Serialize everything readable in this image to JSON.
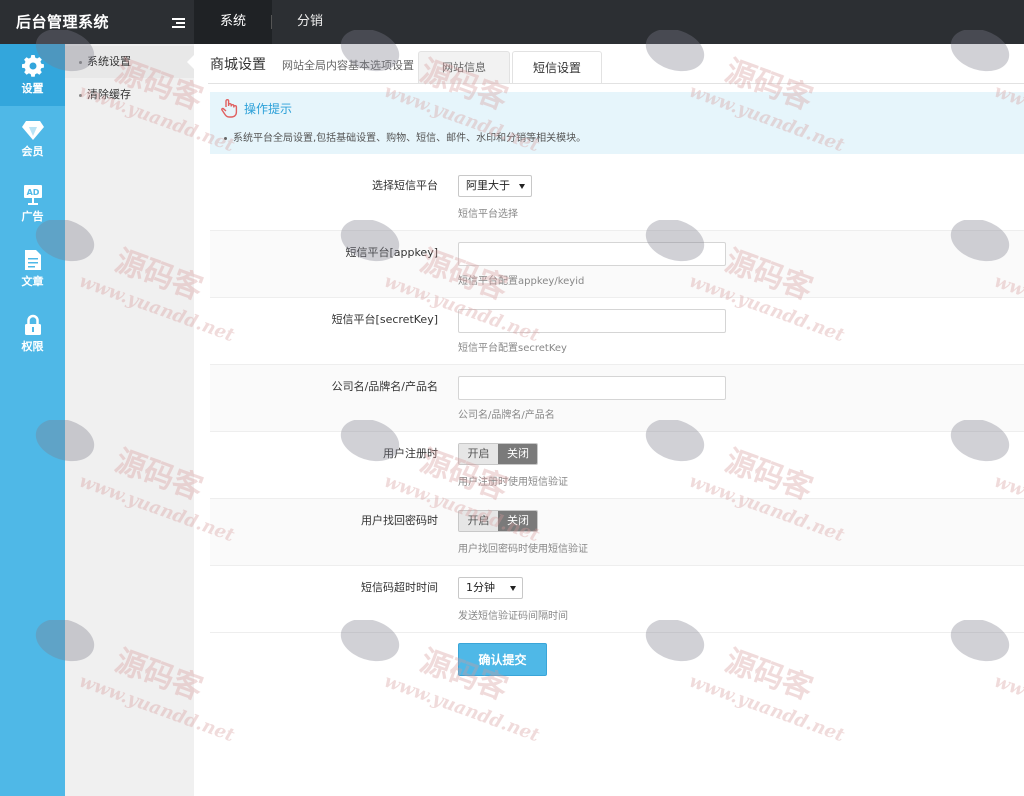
{
  "app": {
    "title": "后台管理系统"
  },
  "topnav": {
    "items": [
      "系统",
      "分销"
    ]
  },
  "sidebar": {
    "items": [
      {
        "label": "设置",
        "icon": "gear-icon"
      },
      {
        "label": "会员",
        "icon": "diamond-icon"
      },
      {
        "label": "广告",
        "icon": "ad-icon"
      },
      {
        "label": "文章",
        "icon": "document-icon"
      },
      {
        "label": "权限",
        "icon": "lock-icon"
      }
    ]
  },
  "submenu": {
    "items": [
      "系统设置",
      "清除缓存"
    ]
  },
  "page": {
    "title": "商城设置",
    "subtitle": "网站全局内容基本选项设置",
    "tabs": [
      "网站信息",
      "短信设置"
    ]
  },
  "tips": {
    "title": "操作提示",
    "text": "系统平台全局设置,包括基础设置、购物、短信、邮件、水印和分销等相关模块。"
  },
  "form": {
    "platform": {
      "label": "选择短信平台",
      "value": "阿里大于",
      "help": "短信平台选择"
    },
    "appkey": {
      "label": "短信平台[appkey]",
      "value": "",
      "help": "短信平台配置appkey/keyid"
    },
    "secret": {
      "label": "短信平台[secretKey]",
      "value": "",
      "help": "短信平台配置secretKey"
    },
    "company": {
      "label": "公司名/品牌名/产品名",
      "value": "",
      "help": "公司名/品牌名/产品名"
    },
    "register": {
      "label": "用户注册时",
      "on": "开启",
      "off": "关闭",
      "help": "用户注册时使用短信验证"
    },
    "recover": {
      "label": "用户找回密码时",
      "on": "开启",
      "off": "关闭",
      "help": "用户找回密码时使用短信验证"
    },
    "timeout": {
      "label": "短信码超时时间",
      "value": "1分钟",
      "help": "发送短信验证码间隔时间"
    },
    "submit": "确认提交"
  },
  "watermark": {
    "brand": "源码客",
    "url": "www.yuandd.net"
  },
  "colors": {
    "topbar": "#2c2f33",
    "accent": "#4fb8e7",
    "tip_bg": "#e6f5fb"
  }
}
